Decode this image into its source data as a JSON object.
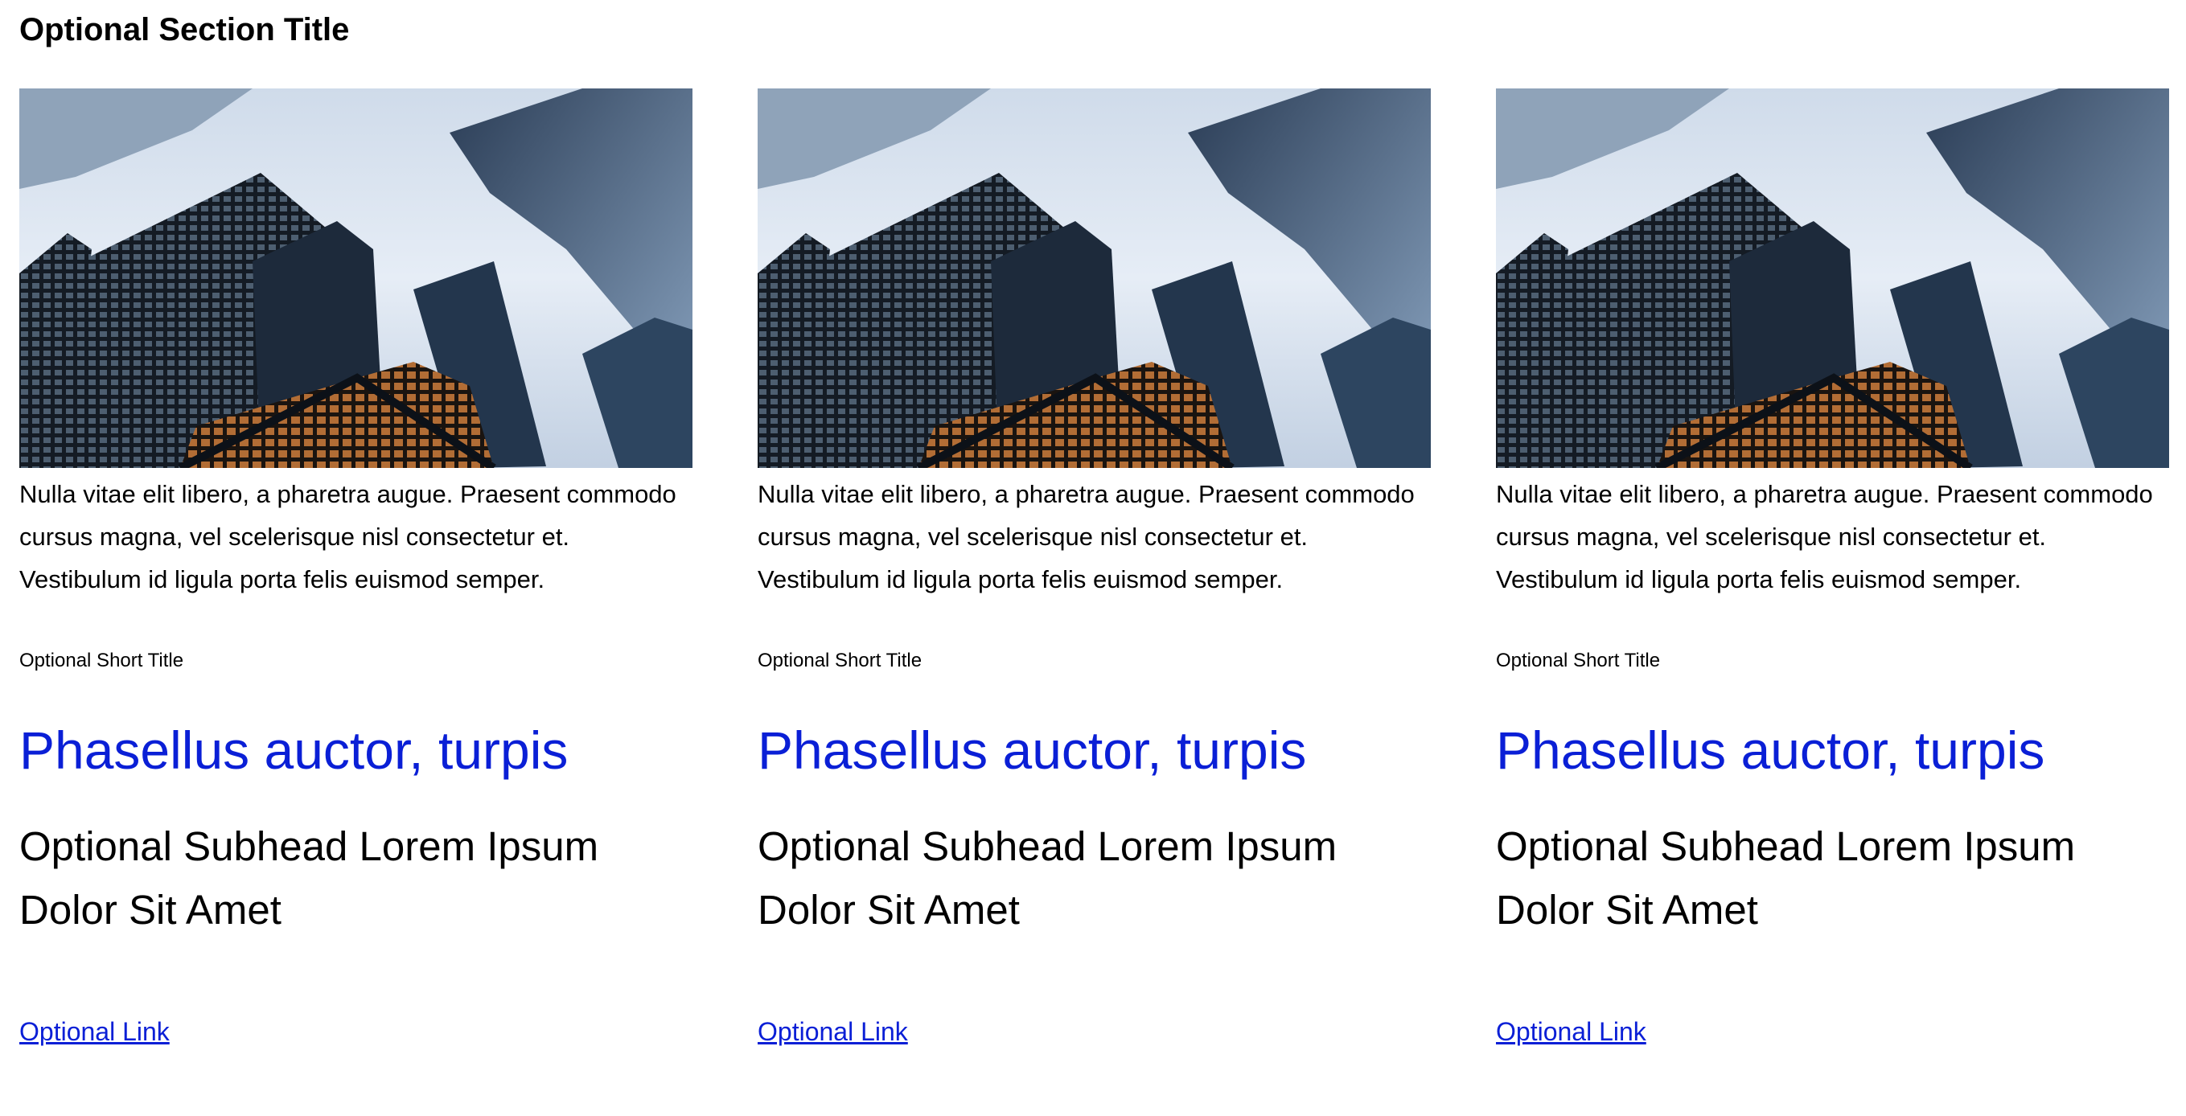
{
  "section": {
    "title": "Optional Section Title"
  },
  "colors": {
    "accent": "#0a1fd6",
    "text": "#000000",
    "background": "#ffffff"
  },
  "cards": [
    {
      "image_subject": "city-skyscrapers-photo",
      "body": "Nulla vitae elit libero, a pharetra augue. Praesent commodo cursus magna, vel scelerisque nisl consectetur et. Vestibulum id ligula porta felis euismod semper.",
      "short_title": "Optional Short Title",
      "heading": "Phasellus auctor, turpis",
      "subhead": "Optional Subhead Lorem Ipsum Dolor Sit Amet",
      "link": "Optional Link"
    },
    {
      "image_subject": "city-skyscrapers-photo",
      "body": "Nulla vitae elit libero, a pharetra augue. Praesent commodo cursus magna, vel scelerisque nisl consectetur et. Vestibulum id ligula porta felis euismod semper.",
      "short_title": "Optional Short Title",
      "heading": "Phasellus auctor, turpis",
      "subhead": "Optional Subhead Lorem Ipsum Dolor Sit Amet",
      "link": "Optional Link"
    },
    {
      "image_subject": "city-skyscrapers-photo",
      "body": "Nulla vitae elit libero, a pharetra augue. Praesent commodo cursus magna, vel scelerisque nisl consectetur et. Vestibulum id ligula porta felis euismod semper.",
      "short_title": "Optional Short Title",
      "heading": "Phasellus auctor, turpis",
      "subhead": "Optional Subhead Lorem Ipsum Dolor Sit Amet",
      "link": "Optional Link"
    }
  ]
}
